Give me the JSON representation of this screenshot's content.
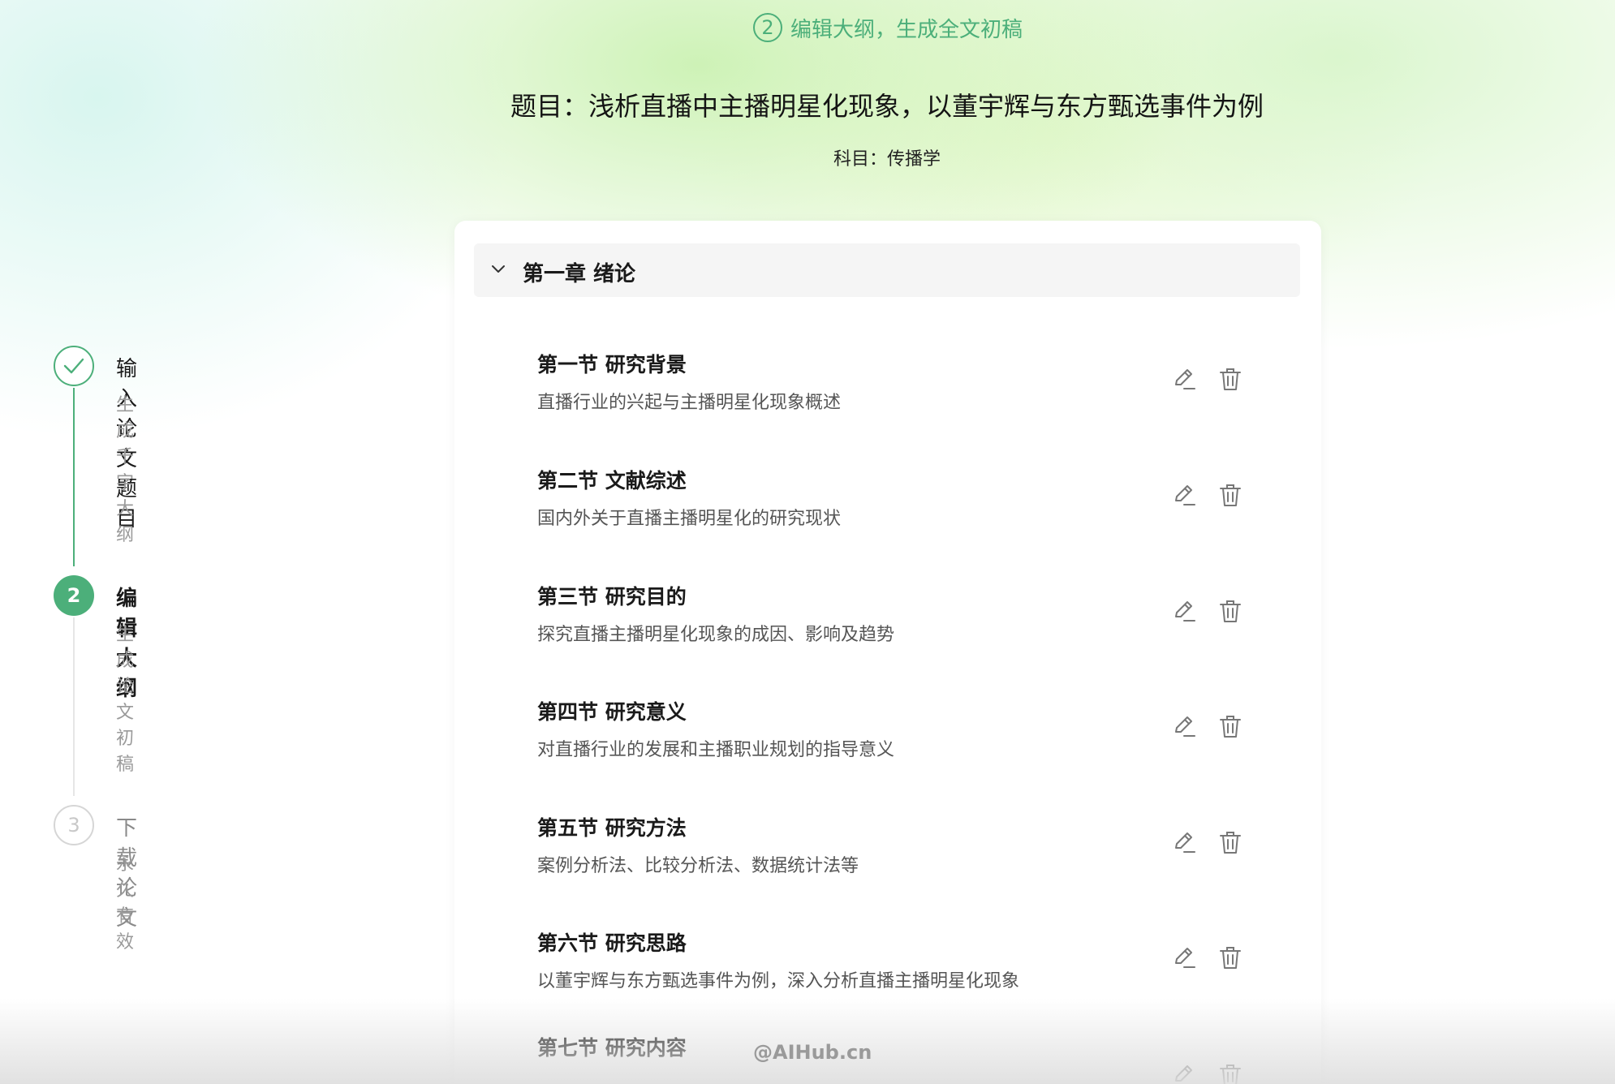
{
  "header": {
    "step_number": "2",
    "step_text": "编辑大纲，生成全文初稿",
    "title": "题目：浅析直播中主播明星化现象，以董宇辉与东方甄选事件为例",
    "subject": "科目：传播学"
  },
  "steps": [
    {
      "title": "输入论文题目",
      "subtitle": "生成千字大纲",
      "state": "done"
    },
    {
      "number": "2",
      "title": "编辑大纲",
      "subtitle": "生成论文初稿",
      "state": "active"
    },
    {
      "number": "3",
      "title": "下载论文",
      "subtitle": "永久有效",
      "state": "pending"
    }
  ],
  "outline": {
    "chapter": {
      "title": "第一章 绪论",
      "expanded": true
    },
    "sections": [
      {
        "title": "第一节 研究背景",
        "desc": "直播行业的兴起与主播明星化现象概述"
      },
      {
        "title": "第二节 文献综述",
        "desc": "国内外关于直播主播明星化的研究现状"
      },
      {
        "title": "第三节 研究目的",
        "desc": "探究直播主播明星化现象的成因、影响及趋势"
      },
      {
        "title": "第四节 研究意义",
        "desc": "对直播行业的发展和主播职业规划的指导意义"
      },
      {
        "title": "第五节 研究方法",
        "desc": "案例分析法、比较分析法、数据统计法等"
      },
      {
        "title": "第六节 研究思路",
        "desc": "以董宇辉与东方甄选事件为例，深入分析直播主播明星化现象"
      },
      {
        "title": "第七节 研究内容",
        "desc": ""
      }
    ]
  },
  "watermark": "@AIHub.cn",
  "colors": {
    "accent": "#4caf7a",
    "muted": "#9a9a9a",
    "chapter_bg": "#f5f5f5"
  }
}
